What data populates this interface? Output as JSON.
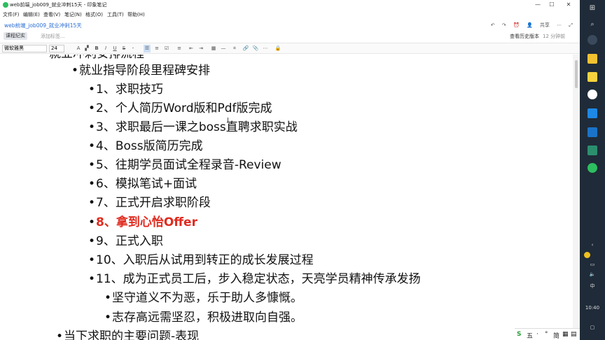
{
  "window": {
    "title": "web前端_job009_就业冲刺15天 - 印象笔记",
    "controls": {
      "minimize": "—",
      "maximize": "☐",
      "close": "✕"
    }
  },
  "menu": [
    "文件(F)",
    "编辑(E)",
    "查看(V)",
    "笔记(N)",
    "格式(O)",
    "工具(T)",
    "帮助(H)"
  ],
  "note": {
    "title": "web前端_job009_就业冲刺15天",
    "share_label": "共享",
    "tag_label": "课程纪实",
    "add_tag_placeholder": "添加标签...",
    "history_label": "查看历史版本",
    "saved_label": "12 分钟前"
  },
  "toolbar": {
    "font_name": "微软雅黑",
    "font_size": "24"
  },
  "content": {
    "top_partial": "就业冲刺安排流程",
    "l1": "就业指导阶段里程碑安排",
    "items": [
      "1、求职技巧",
      "2、个人简历Word版和Pdf版完成",
      "3、求职最后一课之boss直聘求职实战",
      "4、Boss版简历完成",
      "5、往期学员面试全程录音-Review",
      "6、模拟笔试+面试",
      "7、正式开启求职阶段",
      "8、拿到心怡Offer",
      "9、正式入职",
      "10、入职后从试用到转正的成长发展过程",
      "11、成为正式员工后，步入稳定状态，天亮学员精神传承发扬"
    ],
    "sub_items": [
      "坚守道义不为恶，乐于助人多慷慨。",
      "志存高远需坚忍，积极进取向自强。"
    ],
    "bottom_partial": "当下求职的主要问题-表现",
    "highlight_color": "#e02b1f"
  },
  "taskbar": {
    "clock": "10:40",
    "ime_label": "中",
    "ime_bar": [
      "五",
      "·",
      "°",
      "简",
      "▦",
      "▤"
    ]
  }
}
